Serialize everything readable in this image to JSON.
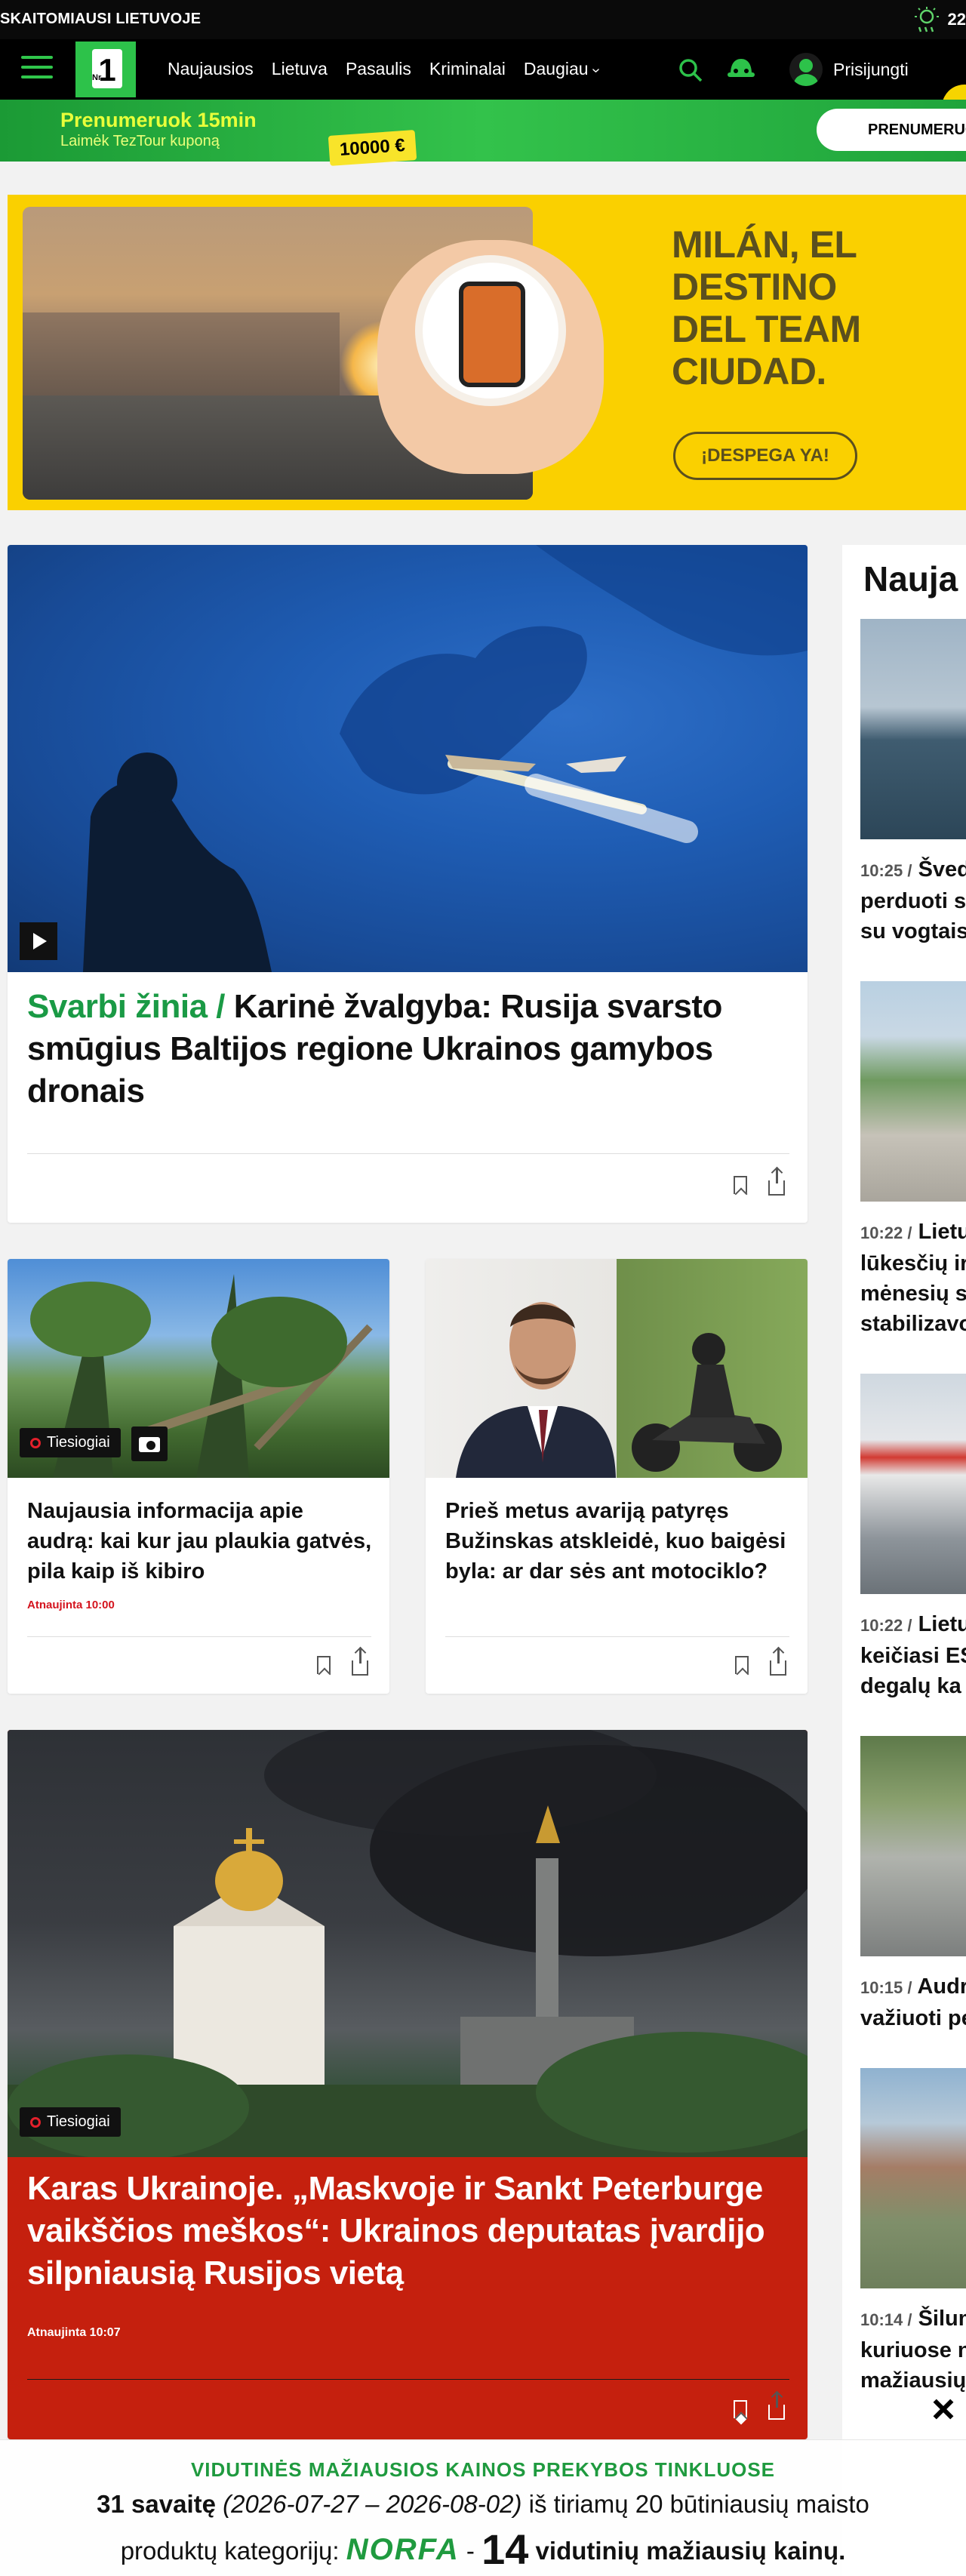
{
  "topbar": {
    "slogan": "SKAITOMIAUSI LIETUVOJE",
    "temperature": "22"
  },
  "nav": {
    "logo_text": "1",
    "logo_sub": "Nr.",
    "links": [
      "Naujausios",
      "Lietuva",
      "Pasaulis",
      "Kriminalai",
      "Daugiau"
    ],
    "login": "Prisijungti"
  },
  "promo": {
    "headline": "Prenumeruok 15min",
    "subline": "Laimėk TezTour kuponą",
    "tag": "10000 €",
    "button": "PRENUMERUO"
  },
  "ad": {
    "headline": [
      "MILÁN, EL",
      "DESTINO",
      "DEL TEAM",
      "CIUDAD."
    ],
    "cta": "¡DESPEGA YA!"
  },
  "hero": {
    "kicker": "Svarbi žinia /",
    "title": "Karinė žvalgyba: Rusija svarsto smūgius Baltijos regione Ukrainos gamybos dronais"
  },
  "cards": [
    {
      "badge": "Tiesiogiai",
      "title": "Naujausia informacija apie audrą: kai kur jau plaukia gatvės, pila kaip iš kibiro",
      "updated": "Atnaujinta 10:00"
    },
    {
      "title": "Prieš metus avariją patyręs Bužinskas atskleidė, kuo baigėsi byla: ar dar sės ant motociklo?"
    }
  ],
  "red_story": {
    "badge": "Tiesiogiai",
    "title": "Karas Ukrainoje. „Maskvoje ir Sankt Peterburge vaikščios meškos“: Ukrainos deputatas įvardijo silpniausią Rusijos vietą",
    "updated": "Atnaujinta 10:07"
  },
  "sidebar": {
    "heading": "Nauja",
    "items": [
      {
        "time": "10:25 /",
        "lines": [
          "Šved",
          "perduoti s",
          "su vogtais"
        ]
      },
      {
        "time": "10:22 /",
        "lines": [
          "Lietu",
          "lūkesčių ir",
          "mėnesių s",
          "stabilizavo"
        ]
      },
      {
        "time": "10:22 /",
        "lines": [
          "Lietu",
          "keičiasi ES",
          "degalų ka"
        ]
      },
      {
        "time": "10:15 /",
        "lines": [
          "Audr",
          "važiuoti pe"
        ]
      },
      {
        "time": "10:14 /",
        "lines": [
          "Šilum",
          "kuriuose n",
          "mažiausių"
        ]
      }
    ]
  },
  "popup": {
    "title": "VIDUTINĖS MAŽIAUSIOS KAINOS PREKYBOS TINKLUOSE",
    "week": "31 savaitę",
    "range": "(2026-07-27 – 2026-08-02)",
    "line1_rest": "iš tiriamų 20 būtiniausių maisto",
    "line2_start": "produktų kategorijų:",
    "brand": "NORFA",
    "dash": "-",
    "count": "14",
    "line2_end": "vidutinių mažiausių kainų."
  },
  "colors": {
    "brand_green": "#2dc24a",
    "kicker_green": "#1a9a45",
    "alert_red": "#c5200e",
    "ad_yellow": "#fad000"
  }
}
